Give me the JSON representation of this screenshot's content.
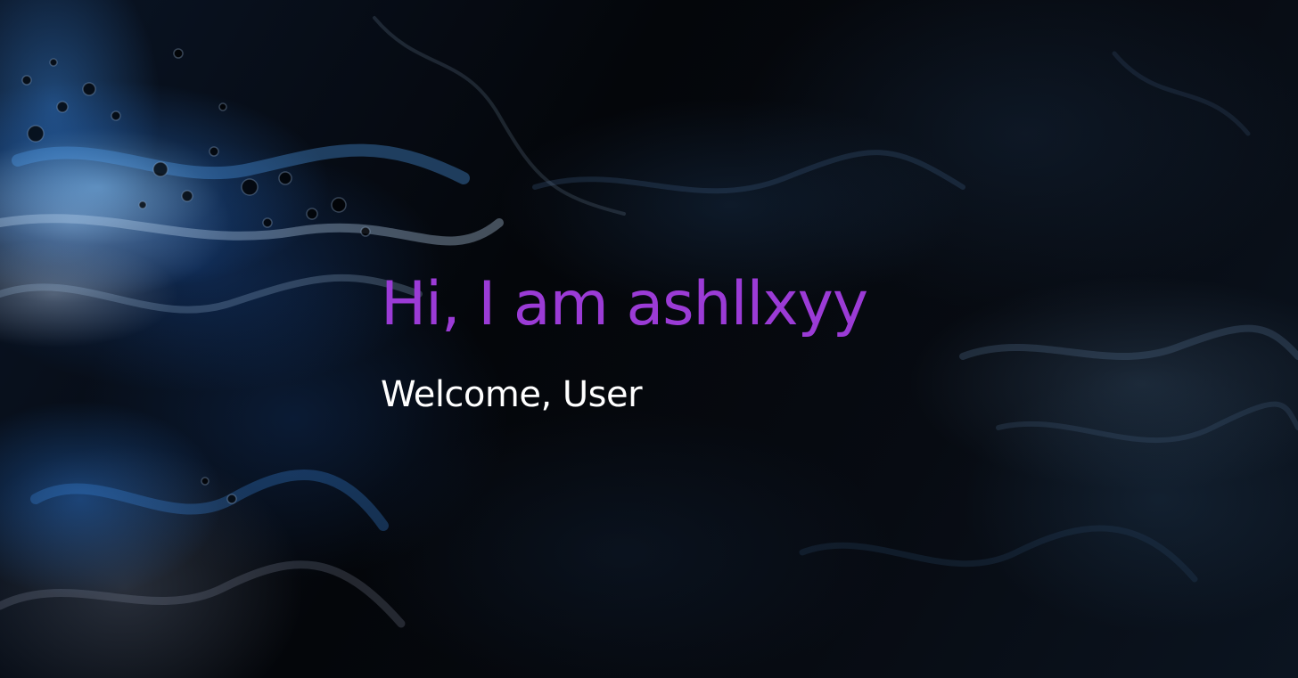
{
  "hero": {
    "background_image": "dark-abstract-fluid-paint",
    "headline": "Hi, I am ashllxyy",
    "subheading": "Welcome, User"
  },
  "colors": {
    "headline": "#9b3bd6",
    "subheading": "#ffffff",
    "background_dark": "#05070b",
    "background_accent": "#2f7fd8"
  }
}
